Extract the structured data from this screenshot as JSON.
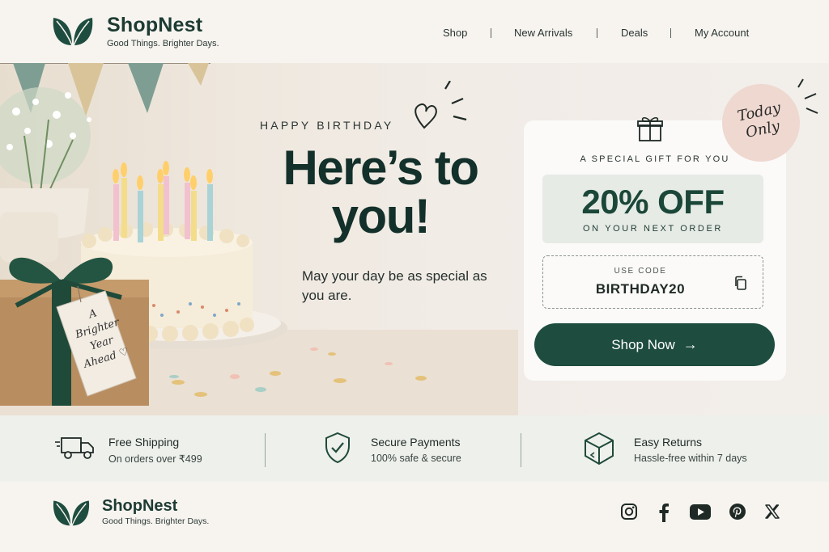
{
  "brand": {
    "name": "ShopNest",
    "tagline": "Good Things. Brighter Days.",
    "color": "#1d3b33"
  },
  "nav": {
    "items": [
      "Shop",
      "New Arrivals",
      "Deals",
      "My Account"
    ]
  },
  "hero": {
    "eyebrow": "HAPPY BIRTHDAY",
    "title_line1": "Here’s to",
    "title_line2": "you!",
    "subtitle": "May your day be as special as you are.",
    "tag_text": [
      "A",
      "Brighter",
      "Year",
      "Ahead ♡"
    ]
  },
  "badge": {
    "line1": "Today",
    "line2": "Only"
  },
  "offer": {
    "gift_label": "A SPECIAL GIFT FOR YOU",
    "discount": "20% OFF",
    "discount_note": "ON YOUR NEXT ORDER",
    "code_label": "USE CODE",
    "code": "BIRTHDAY20",
    "cta": "Shop Now",
    "cta_color": "#1e4d3f"
  },
  "features": [
    {
      "title": "Free Shipping",
      "desc": "On orders over ₹499",
      "icon": "truck-icon"
    },
    {
      "title": "Secure Payments",
      "desc": "100% safe & secure",
      "icon": "shield-check-icon"
    },
    {
      "title": "Easy Returns",
      "desc": "Hassle-free within 7 days",
      "icon": "box-return-icon"
    }
  ],
  "footer": {
    "brand_name": "ShopNest",
    "tagline": "Good Things. Brighter Days.",
    "social": [
      "instagram-icon",
      "facebook-icon",
      "youtube-icon",
      "pinterest-icon",
      "x-icon"
    ]
  }
}
